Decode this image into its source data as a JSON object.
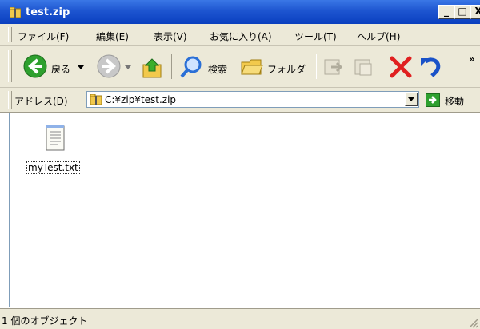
{
  "window": {
    "title": "test.zip",
    "caption_buttons": {
      "minimize": "_",
      "maximize": "□",
      "close": "X"
    }
  },
  "menubar": {
    "items": [
      {
        "label": "ファイル(F)"
      },
      {
        "label": "編集(E)"
      },
      {
        "label": "表示(V)"
      },
      {
        "label": "お気に入り(A)"
      },
      {
        "label": "ツール(T)"
      },
      {
        "label": "ヘルプ(H)"
      }
    ]
  },
  "toolbar": {
    "back_label": "戻る",
    "search_label": "検索",
    "folders_label": "フォルダ",
    "overflow": "»"
  },
  "addressbar": {
    "label": "アドレス(D)",
    "value": "C:¥zip¥test.zip",
    "go_label": "移動"
  },
  "content": {
    "files": [
      {
        "name": "myTest.txt",
        "icon": "text-file-icon"
      }
    ]
  },
  "statusbar": {
    "text": "1 個のオブジェクト"
  },
  "colors": {
    "titlebar": "#0a3fbf",
    "chrome": "#ece9d8",
    "back_green": "#2ea02e",
    "close_red": "#e02020",
    "undo_blue": "#1a52c8"
  }
}
